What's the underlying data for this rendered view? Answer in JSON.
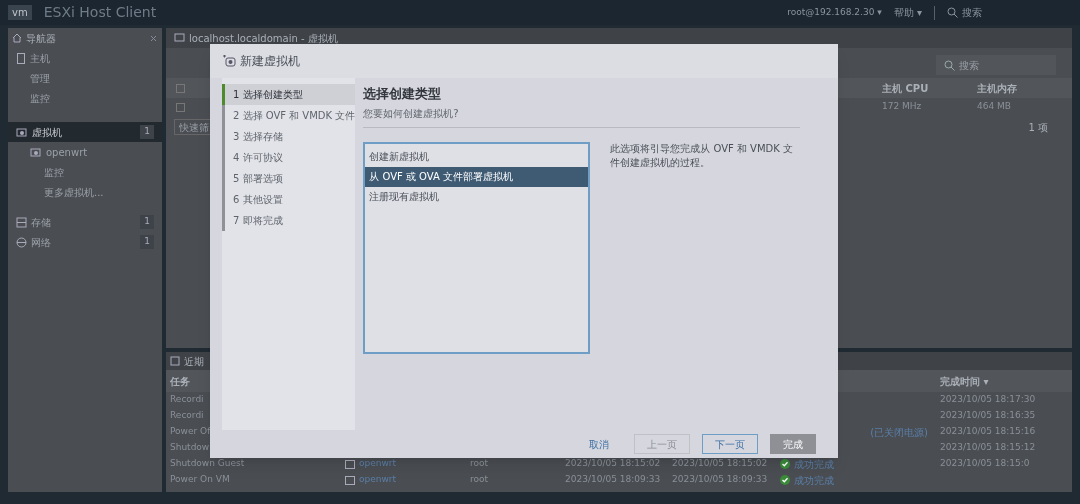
{
  "header": {
    "logo": "vm",
    "title": "ESXi Host Client",
    "user": "root@192.168.2.30 ▾",
    "help": "帮助 ▾",
    "search": "搜索"
  },
  "navigator": {
    "title": "导航器",
    "items": [
      {
        "label": "主机",
        "kind": "host",
        "selected": false,
        "children": [
          {
            "label": "管理",
            "selected": false
          },
          {
            "label": "监控",
            "selected": false
          }
        ]
      },
      {
        "label": "虚拟机",
        "kind": "vms",
        "selected": true,
        "badge": "1",
        "children": [
          {
            "label": "openwrt",
            "kind": "vm",
            "selected": false,
            "children": [
              {
                "label": "监控",
                "selected": false
              },
              {
                "label": "更多虚拟机...",
                "selected": false
              }
            ]
          }
        ]
      },
      {
        "label": "存储",
        "kind": "storage",
        "selected": false,
        "badge": "1"
      },
      {
        "label": "网络",
        "kind": "network",
        "selected": false,
        "badge": "1"
      }
    ]
  },
  "main": {
    "checkboxes": [
      {
        "checked": false
      },
      {
        "checked": false
      }
    ],
    "breadcrumb": "localhost.localdomain - 虚拟机",
    "search_placeholder": "搜索",
    "quick_filter": "快速筛",
    "columns": [
      "主机 CPU",
      "主机内存"
    ],
    "row": [
      "172 MHz",
      "464 MB"
    ],
    "count": "1 项"
  },
  "tasks": {
    "title": "近期",
    "columns": {
      "task": "任务",
      "completed": "完成时间 ▾"
    },
    "rows": [
      {
        "task": "Recordi",
        "completed": "2023/10/05 18:17:30"
      },
      {
        "task": "Recordi",
        "completed": "2023/10/05 18:16:35"
      },
      {
        "task": "Power Of",
        "result_tail": "(已关闭电源)",
        "completed": "2023/10/05 18:15:16"
      },
      {
        "task": "Shutdow",
        "completed": "2023/10/05 18:15:12"
      },
      {
        "task": "Shutdown Guest",
        "target": "openwrt",
        "initiator": "root",
        "queued": "2023/10/05 18:15:02",
        "started": "2023/10/05 18:15:02",
        "result": "成功完成",
        "completed": "2023/10/05 18:15:0"
      },
      {
        "task": "Power On VM",
        "target": "openwrt",
        "initiator": "root",
        "queued": "2023/10/05 18:09:33",
        "started": "2023/10/05 18:09:33",
        "result": "成功完成"
      }
    ]
  },
  "dialog": {
    "title": "新建虚拟机",
    "steps": [
      {
        "label": "1 选择创建类型",
        "selected": true
      },
      {
        "label": "2 选择 OVF 和 VMDK 文件",
        "selected": false
      },
      {
        "label": "3 选择存储",
        "selected": false
      },
      {
        "label": "4 许可协议",
        "selected": false
      },
      {
        "label": "5 部署选项",
        "selected": false
      },
      {
        "label": "6 其他设置",
        "selected": false
      },
      {
        "label": "7 即将完成",
        "selected": false
      }
    ],
    "heading": "选择创建类型",
    "subheading": "您要如何创建虚拟机?",
    "options": [
      {
        "label": "创建新虚拟机",
        "selected": false
      },
      {
        "label": "从 OVF 或 OVA 文件部署虚拟机",
        "selected": true
      },
      {
        "label": "注册现有虚拟机",
        "selected": false
      }
    ],
    "description": "此选项将引导您完成从 OVF 和 VMDK 文件创建虚拟机的过程。",
    "buttons": [
      {
        "label": "取消",
        "kind": "link",
        "disabled": false
      },
      {
        "label": "上一页",
        "kind": "normal",
        "disabled": true
      },
      {
        "label": "下一页",
        "kind": "primary",
        "disabled": false
      },
      {
        "label": "完成",
        "kind": "finish",
        "disabled": true
      }
    ]
  }
}
